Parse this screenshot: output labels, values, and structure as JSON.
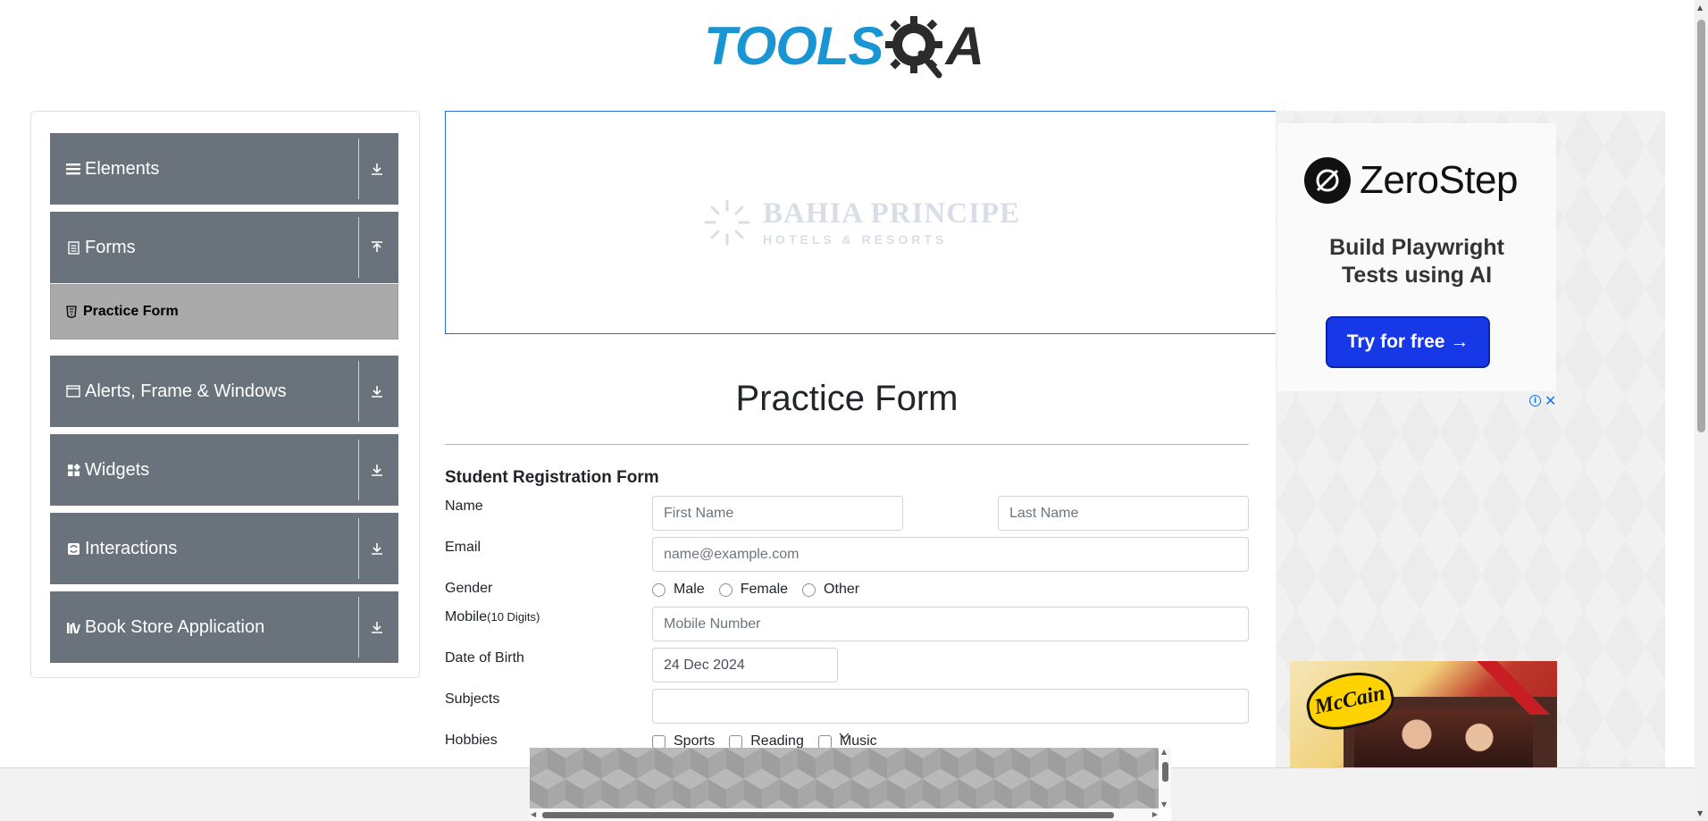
{
  "header": {
    "logo_text": "TOOLS",
    "logo_suffix": "A"
  },
  "sidebar": {
    "groups": [
      {
        "label": "Elements",
        "icon": "hamburger-icon",
        "arrow": "download-arrow-icon"
      },
      {
        "label": "Forms",
        "icon": "document-icon",
        "arrow": "upload-arrow-icon"
      },
      {
        "label": "Alerts, Frame & Windows",
        "icon": "window-icon",
        "arrow": "download-arrow-icon"
      },
      {
        "label": "Widgets",
        "icon": "widgets-icon",
        "arrow": "download-arrow-icon"
      },
      {
        "label": "Interactions",
        "icon": "interactions-icon",
        "arrow": "download-arrow-icon"
      },
      {
        "label": "Book Store Application",
        "icon": "books-icon",
        "arrow": "download-arrow-icon"
      }
    ],
    "forms_items": [
      {
        "label": "Practice Form",
        "icon": "html5-icon"
      }
    ]
  },
  "banner": {
    "brand": "BAHIA PRINCIPE",
    "sub": "HOTELS & RESORTS"
  },
  "main": {
    "title": "Practice Form",
    "form_heading": "Student Registration Form",
    "labels": {
      "name": "Name",
      "email": "Email",
      "gender": "Gender",
      "mobile": "Mobile",
      "mobile_hint": "(10 Digits)",
      "dob": "Date of Birth",
      "subjects": "Subjects",
      "hobbies": "Hobbies"
    },
    "inputs": {
      "first_name_placeholder": "First Name",
      "last_name_placeholder": "Last Name",
      "email_placeholder": "name@example.com",
      "mobile_placeholder": "Mobile Number",
      "dob_value": "24 Dec 2024",
      "subjects_value": ""
    },
    "gender_options": [
      "Male",
      "Female",
      "Other"
    ],
    "hobby_options": [
      "Sports",
      "Reading",
      "Music"
    ]
  },
  "ads": {
    "zerostep": {
      "name": "ZeroStep",
      "tagline_1": "Build Playwright",
      "tagline_2": "Tests using AI",
      "cta": "Try for free →"
    },
    "mccain": {
      "brand": "McCain"
    }
  },
  "colors": {
    "sidebar_group_bg": "#6a737b",
    "sidebar_active_bg": "#aaaaaa",
    "logo_blue": "#1a95d3",
    "banner_border": "#2a6cd6",
    "cta_blue": "#1638e6"
  }
}
